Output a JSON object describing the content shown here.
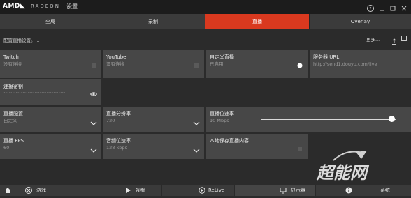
{
  "window": {
    "logo": "AMD◣",
    "brand": "RADEON",
    "title": "设置",
    "controls": [
      "help-icon",
      "minimize-icon",
      "maximize-icon",
      "close-icon"
    ]
  },
  "tabs": [
    {
      "label": "全局",
      "active": false
    },
    {
      "label": "录制",
      "active": false
    },
    {
      "label": "直播",
      "active": true
    },
    {
      "label": "Overlay",
      "active": false
    }
  ],
  "subbar": {
    "left": "配置直播设置。...",
    "more": "更多..."
  },
  "tiles": {
    "twitch": {
      "title": "Twitch",
      "value": "没有连接"
    },
    "youtube": {
      "title": "YouTube",
      "value": "没有连接"
    },
    "custom": {
      "title": "自定义直播",
      "value": "已启用"
    },
    "server": {
      "title": "服务器 URL",
      "value": "http://send1.douyu.com/live"
    },
    "stream_key": {
      "title": "连接密钥",
      "value": "••••••••••••••••••••••••••••••••••••"
    },
    "profile": {
      "title": "直播配置",
      "value": "自定义"
    },
    "resolution": {
      "title": "直播分辨率",
      "value": "720"
    },
    "bitrate": {
      "title": "直播位速率",
      "value": "10 Mbps",
      "level": 0.97
    },
    "fps": {
      "title": "直播 FPS",
      "value": "60"
    },
    "audio_bitrate": {
      "title": "音频位速率",
      "value": "128 kbps"
    },
    "save_local": {
      "title": "本地保存直播内容",
      "value": ""
    }
  },
  "watermark": "超能网",
  "bottom_nav": [
    {
      "label": "",
      "icon": "home-icon"
    },
    {
      "label": "游戏",
      "icon": "gamepad-icon"
    },
    {
      "label": "视频",
      "icon": "play-icon"
    },
    {
      "label": "ReLive",
      "icon": "relive-icon"
    },
    {
      "label": "显示器",
      "icon": "monitor-icon"
    },
    {
      "label": "系统",
      "icon": "info-icon"
    }
  ],
  "colors": {
    "accent": "#d9391f",
    "tile": "#474747",
    "background": "#2b2b2b"
  }
}
